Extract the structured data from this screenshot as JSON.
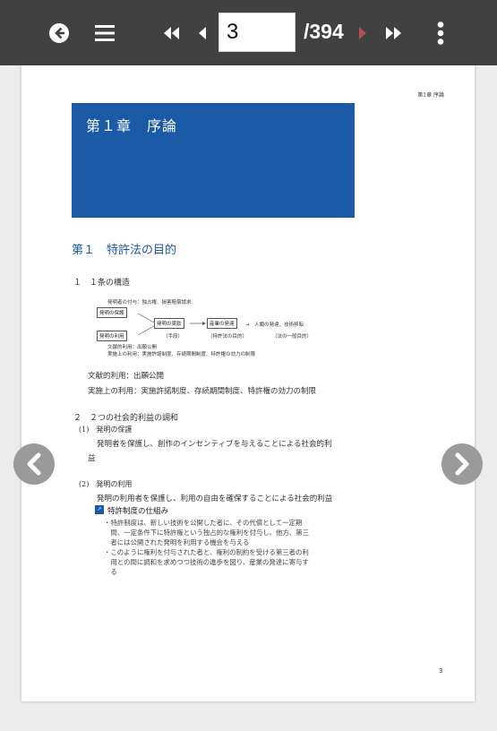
{
  "toolbar": {
    "page_value": "3",
    "page_total": "/394",
    "icons": [
      "back-circle-icon",
      "menu-icon",
      "first-page-icon",
      "prev-page-icon",
      "next-page-icon",
      "last-page-icon",
      "more-vert-icon"
    ]
  },
  "page": {
    "running_head": "第1章 序論",
    "chapter_title": "第１章　序論",
    "section_heading": "第１　特許法の目的",
    "sub1_heading": "１　１条の構造",
    "diagram": {
      "top_note": "発明者の付与：独占権、損害賠償請求",
      "box_protect": "発明の保護",
      "box_use": "発明の利用",
      "box_encourage": "発明の奨励",
      "box_industry": "産業の発達",
      "arrow_text": "→　人類の発達、技術移転",
      "label_means": "（手段）",
      "label_purpose": "（特許法の目的）",
      "label_final": "（法の一般目的）",
      "bottom1": "文献的利用：出願公開",
      "bottom2": "実施上の利用：実施許諾制度、存続期間制度、特許権の効力の制限"
    },
    "line_lit": "文献的利用：出願公開",
    "line_impl": "実施上の利用：実施許諾制度、存続期間制度、特許権の効力の制限",
    "sub2_heading": "２　２つの社会的利益の調和",
    "item1_label": "(1)　発明の保護",
    "item1_text_a": "発明者を保護し、創作のインセンティブを与えることによる社会的利",
    "item1_text_b": "益",
    "item2_label": "(2)　発明の利用",
    "item2_text": "発明の利用者を保護し、利用の自由を確保することによる社会的利益",
    "badge_char": "↗",
    "mechanism_title": "特許制度の仕組み",
    "bullets": [
      "・特許制度は、新しい技術を公開した者に、その代償として一定期",
      "　間、一定条件下に特許権という独占的な権利を付与し、他方、第三",
      "　者には公開された発明を利用する機会を与える",
      "・このように権利を付与された者と、権利の制約を受ける第三者の利",
      "　用との間に調和を求めつつ技術の進歩を図り、産業の発達に寄与す",
      "　る"
    ],
    "page_number": "3"
  },
  "colors": {
    "toolbar_bg": "#414141",
    "accent_blue": "#1a5aa6",
    "next_disabled": "#b5504a"
  }
}
